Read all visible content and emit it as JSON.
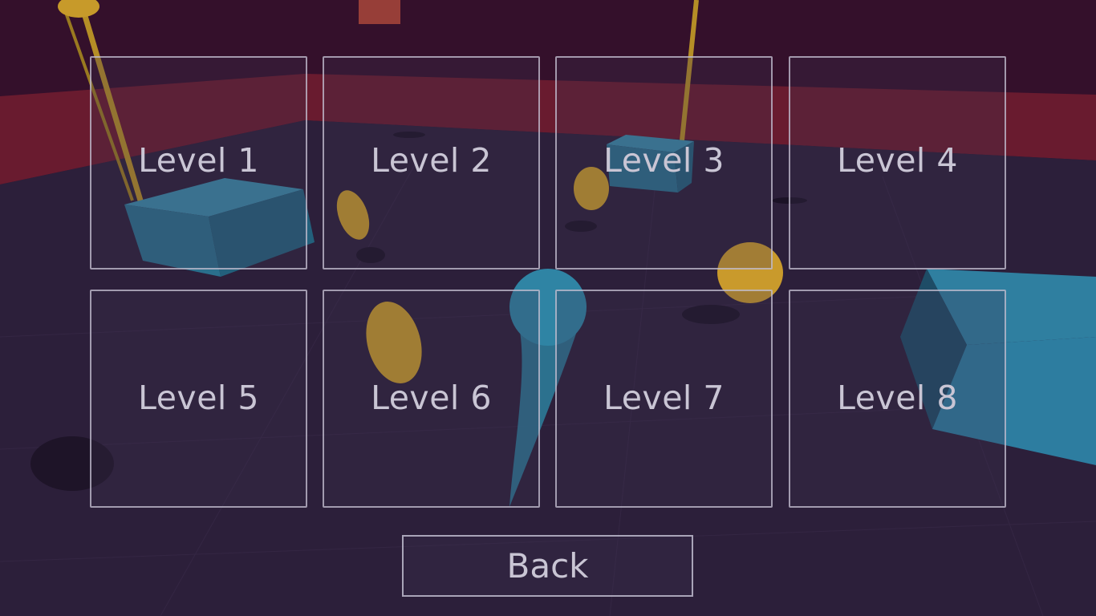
{
  "level_select": {
    "levels": [
      {
        "label": "Level 1"
      },
      {
        "label": "Level 2"
      },
      {
        "label": "Level 3"
      },
      {
        "label": "Level 4"
      },
      {
        "label": "Level 5"
      },
      {
        "label": "Level 6"
      },
      {
        "label": "Level 7"
      },
      {
        "label": "Level 8"
      }
    ],
    "back_label": "Back"
  },
  "colors": {
    "sky": "#3a0f2c",
    "wall": "#6a1a2e",
    "floor": "#2b1f3a",
    "block": "#2a6a88",
    "coin": "#c79a2a",
    "button_border": "#c8c4d6",
    "button_text": "#c9c5d4"
  }
}
